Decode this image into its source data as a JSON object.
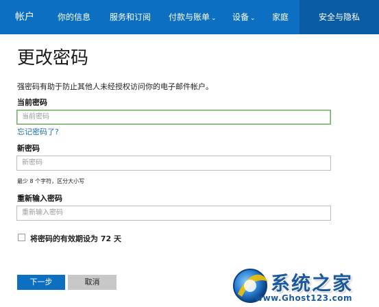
{
  "nav": {
    "brand": "帐户",
    "items": [
      {
        "label": "你的信息",
        "dropdown": false
      },
      {
        "label": "服务和订阅",
        "dropdown": false
      },
      {
        "label": "付款与账单",
        "dropdown": true
      },
      {
        "label": "设备",
        "dropdown": true
      },
      {
        "label": "家庭",
        "dropdown": false
      },
      {
        "label": "安全与隐私",
        "dropdown": false,
        "active": true
      }
    ]
  },
  "page": {
    "title": "更改密码",
    "description": "强密码有助于防止其他人未经授权访问你的电子邮件帐户。"
  },
  "form": {
    "current_label": "当前密码",
    "current_placeholder": "当前密码",
    "forgot_link": "忘记密码了?",
    "new_label": "新密码",
    "new_placeholder": "新密码",
    "new_hint": "最少 8 个字符，区分大小写",
    "confirm_label": "重新输入密码",
    "confirm_placeholder": "重新输入密码",
    "expire_checkbox_label": "将密码的有效期设为 72 天",
    "expire_checked": false
  },
  "buttons": {
    "next": "下一步",
    "cancel": "取消"
  },
  "watermark": {
    "text": "系统之家",
    "url": "www.Ghost123.com"
  },
  "colors": {
    "nav_bg": "#0c6fc1",
    "nav_active": "#0a5ca4",
    "link": "#1a6fb6",
    "focus_border": "#78a96e"
  }
}
